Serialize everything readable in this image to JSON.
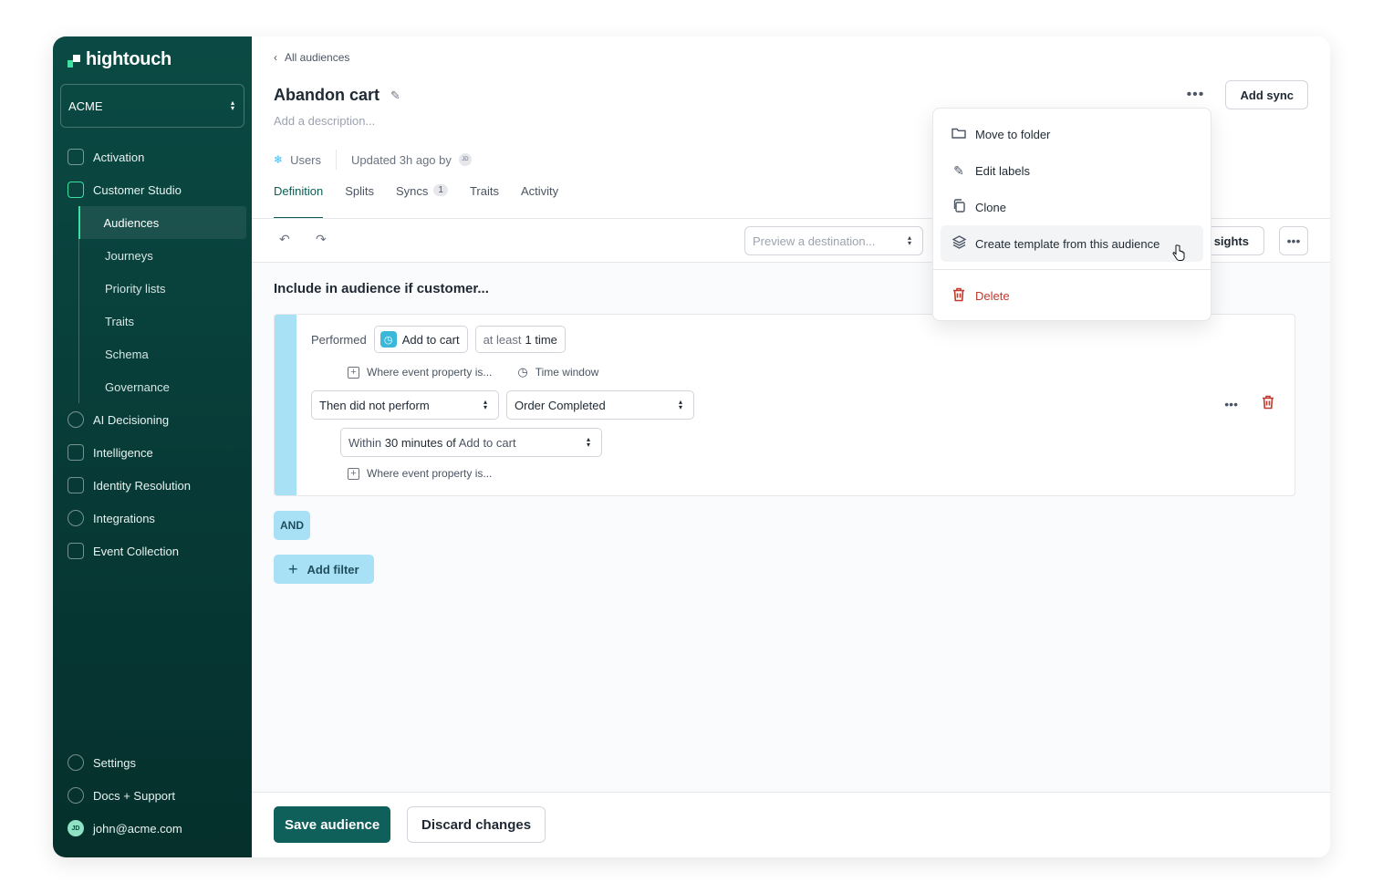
{
  "app": {
    "logo": "hightouch",
    "workspace": "ACME"
  },
  "sidebar": {
    "items": [
      {
        "label": "Activation",
        "icon": "grid-icon"
      },
      {
        "label": "Customer Studio",
        "icon": "user-frame-icon"
      }
    ],
    "sub_items": [
      "Audiences",
      "Journeys",
      "Priority lists",
      "Traits",
      "Schema",
      "Governance"
    ],
    "more_items": [
      {
        "label": "AI Decisioning",
        "icon": "ai-icon"
      },
      {
        "label": "Intelligence",
        "icon": "chart-icon"
      },
      {
        "label": "Identity Resolution",
        "icon": "identity-icon"
      },
      {
        "label": "Integrations",
        "icon": "integrations-icon"
      },
      {
        "label": "Event Collection",
        "icon": "event-icon"
      }
    ],
    "bottom": {
      "settings": "Settings",
      "docs": "Docs + Support",
      "user": "john@acme.com",
      "user_initials": "JD"
    }
  },
  "header": {
    "breadcrumb": "All audiences",
    "title": "Abandon cart",
    "description_placeholder": "Add a description...",
    "model": "Users",
    "updated": "Updated 3h ago by",
    "updated_initials": "JD",
    "add_sync": "Add sync"
  },
  "tabs": [
    {
      "label": "Definition"
    },
    {
      "label": "Splits"
    },
    {
      "label": "Syncs",
      "badge": "1"
    },
    {
      "label": "Traits"
    },
    {
      "label": "Activity"
    }
  ],
  "toolbar": {
    "preview_placeholder": "Preview a destination...",
    "insights": "sights"
  },
  "builder": {
    "include_title": "Include in audience if customer...",
    "performed": "Performed",
    "event": "Add to cart",
    "freq_prefix": "at least",
    "freq_value": "1 time",
    "where_property": "Where event property is...",
    "time_window": "Time window",
    "then_did_not": "Then did not perform",
    "event2": "Order Completed",
    "within_prefix": "Within",
    "within_value": "30 minutes of",
    "within_event": "Add to cart",
    "where_property2": "Where event property is...",
    "and": "AND",
    "add_filter": "Add filter"
  },
  "footer": {
    "save": "Save audience",
    "discard": "Discard changes"
  },
  "menu": {
    "move": "Move to folder",
    "labels": "Edit labels",
    "clone": "Clone",
    "template": "Create template from this audience",
    "delete": "Delete"
  },
  "colors": {
    "brand": "#0b4a44",
    "accent": "#3ee0a0",
    "filter": "#a8e0f5",
    "danger": "#c0392b"
  }
}
